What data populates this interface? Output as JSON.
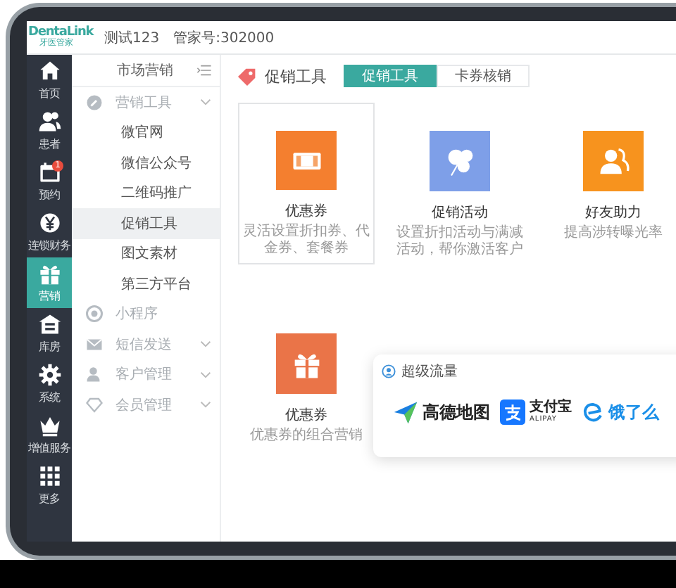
{
  "brand": {
    "logo": "DentaLink",
    "sub": "牙医管家"
  },
  "header": {
    "user": "测试123",
    "account": "管家号:302000"
  },
  "nav": [
    {
      "label": "首页",
      "selected": false
    },
    {
      "label": "患者",
      "selected": false
    },
    {
      "label": "预约",
      "selected": false,
      "badge": "1"
    },
    {
      "label": "连锁财务",
      "selected": false
    },
    {
      "label": "营销",
      "selected": true
    },
    {
      "label": "库房",
      "selected": false
    },
    {
      "label": "系统",
      "selected": false
    },
    {
      "label": "增值服务",
      "selected": false
    },
    {
      "label": "更多",
      "selected": false
    }
  ],
  "sidebar": {
    "title": "市场营销",
    "groups": [
      {
        "label": "营销工具",
        "kind": "folder",
        "children": [
          {
            "label": "微官网",
            "selected": false
          },
          {
            "label": "微信公众号",
            "selected": false
          },
          {
            "label": "二维码推广",
            "selected": false
          },
          {
            "label": "促销工具",
            "selected": true
          },
          {
            "label": "图文素材",
            "selected": false
          },
          {
            "label": "第三方平台",
            "selected": false
          }
        ]
      },
      {
        "label": "小程序",
        "kind": "link"
      },
      {
        "label": "短信发送",
        "kind": "folder"
      },
      {
        "label": "客户管理",
        "kind": "folder"
      },
      {
        "label": "会员管理",
        "kind": "folder"
      }
    ]
  },
  "main": {
    "title": "促销工具",
    "tabs": [
      {
        "label": "促销工具",
        "selected": true
      },
      {
        "label": "卡券核销",
        "selected": false
      }
    ],
    "tools": [
      {
        "name": "优惠券",
        "desc": "灵活设置折扣券、代金券、套餐券",
        "color": "#f47f2f",
        "selected": true
      },
      {
        "name": "促销活动",
        "desc": "设置折扣活动与满减活动，帮你激活客户",
        "color": "#7e9fe8",
        "selected": false
      },
      {
        "name": "好友助力",
        "desc": "提高涉转曝光率",
        "color": "#f7931e",
        "selected": false
      },
      {
        "name": "优惠券",
        "desc": "优惠券的组合营销",
        "color": "#ea7448",
        "selected": false
      }
    ],
    "traffic": {
      "title": "超级流量",
      "partners": [
        {
          "kind": "amap",
          "name": "高德地图"
        },
        {
          "kind": "alipay",
          "name": "支付宝",
          "sub": "ALIPAY"
        },
        {
          "kind": "eleme",
          "name": "饿了么"
        }
      ]
    }
  }
}
